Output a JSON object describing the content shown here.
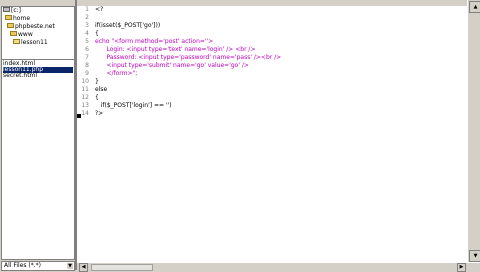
{
  "tree": {
    "items": [
      {
        "label": "[c:]",
        "icon": "drive-icon",
        "indent": 0
      },
      {
        "label": "home",
        "icon": "folder-icon",
        "indent": 1
      },
      {
        "label": "phpbeste.net",
        "icon": "folder-icon",
        "indent": 2
      },
      {
        "label": "www",
        "icon": "folder-icon",
        "indent": 3
      },
      {
        "label": "lesson11",
        "icon": "folder-open-icon",
        "indent": 4
      }
    ]
  },
  "files": {
    "items": [
      {
        "label": "index.html",
        "selected": false
      },
      {
        "label": "lesson11.php",
        "selected": true
      },
      {
        "label": "secret.html",
        "selected": false
      }
    ]
  },
  "filter": {
    "label": "All Files (*.*)"
  },
  "editor": {
    "lines": [
      {
        "n": "1",
        "text": "<?"
      },
      {
        "n": "2",
        "text": ""
      },
      {
        "n": "3",
        "text": "if(isset($_POST['go']))"
      },
      {
        "n": "4",
        "text": "{"
      },
      {
        "n": "5",
        "text": "echo \"<form method='post' action=''>"
      },
      {
        "n": "6",
        "text": "      Login: <input type='text' name='login' /> <br />"
      },
      {
        "n": "7",
        "text": "      Password: <input type='password' name='pass' /><br />"
      },
      {
        "n": "8",
        "text": "      <input type='submit' name='go' value='go' />"
      },
      {
        "n": "9",
        "text": "      </form>\";"
      },
      {
        "n": "10",
        "text": "}"
      },
      {
        "n": "11",
        "text": "else"
      },
      {
        "n": "12",
        "text": "{"
      },
      {
        "n": "13",
        "text": "   if($_POST['login'] == '')"
      },
      {
        "n": "14",
        "text": "?>"
      }
    ]
  }
}
